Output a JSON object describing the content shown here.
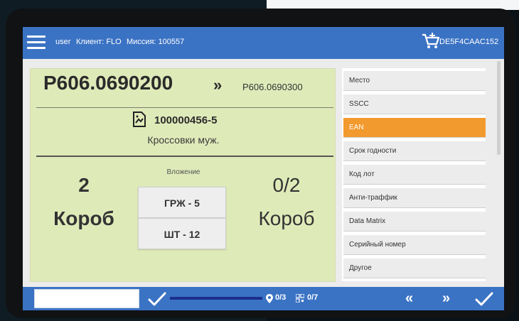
{
  "header": {
    "user": "user",
    "client_label": "Клиент: FLO",
    "mission_label": "Миссия: 100557",
    "device_id": "DE5F4CAAC152"
  },
  "main": {
    "current_code": "P606.0690200",
    "next_code": "P606.0690300",
    "article_code": "100000456-5",
    "product_name": "Кроссовки муж.",
    "nesting_label": "Вложение",
    "left_qty": "2",
    "left_unit": "Короб",
    "right_qty": "0/2",
    "right_unit": "Короб",
    "pack_buttons": [
      "ГРЖ - 5",
      "ШТ - 12"
    ]
  },
  "list": {
    "items": [
      {
        "label": "Место",
        "active": false
      },
      {
        "label": "SSCC",
        "active": false
      },
      {
        "label": "EAN",
        "active": true
      },
      {
        "label": "Срок годности",
        "active": false
      },
      {
        "label": "Код лот",
        "active": false
      },
      {
        "label": "Анти-траффик",
        "active": false
      },
      {
        "label": "Data Matrix",
        "active": false
      },
      {
        "label": "Серийный номер",
        "active": false
      },
      {
        "label": "Другое",
        "active": false
      }
    ],
    "active_color": "#f29a2e"
  },
  "bottom": {
    "scan_value": "",
    "locations_stat": "0/3",
    "codes_stat": "0/7",
    "progress": 0.0
  },
  "colors": {
    "topbar": "#3b73c4",
    "main_panel": "#dfeab9"
  }
}
